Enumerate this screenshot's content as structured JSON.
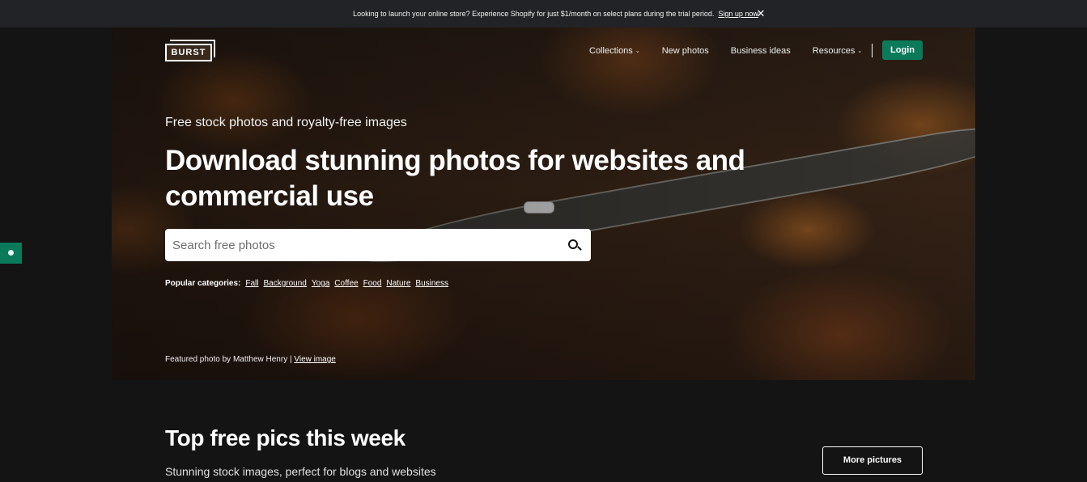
{
  "announcement": {
    "message": "Looking to launch your online store? Experience Shopify for just $1/month on select plans during the trial period.",
    "link": "Sign up now",
    "close_icon": "close-icon"
  },
  "header": {
    "logo": "BURST",
    "nav": [
      {
        "label": "Collections",
        "has_dropdown": true
      },
      {
        "label": "New photos",
        "has_dropdown": false
      },
      {
        "label": "Business ideas",
        "has_dropdown": false
      },
      {
        "label": "Resources",
        "has_dropdown": true
      }
    ],
    "login": "Login"
  },
  "hero": {
    "kicker": "Free stock photos and royalty-free images",
    "headline": "Download stunning photos for websites and commercial use",
    "search": {
      "placeholder": "Search free photos",
      "icon": "search-icon"
    },
    "popular": {
      "label": "Popular categories:",
      "categories": [
        "Fall",
        "Background",
        "Yoga",
        "Coffee",
        "Food",
        "Nature",
        "Business"
      ]
    },
    "credit": {
      "text": "Featured photo by Matthew Henry |",
      "link": "View image"
    }
  },
  "section": {
    "title": "Top free pics this week",
    "subtitle": "Stunning stock images, perfect for blogs and websites",
    "more_button": "More pictures"
  },
  "colors": {
    "accent": "#0b7a5a",
    "announcement_bg": "#212326",
    "page_bg": "#141414"
  }
}
